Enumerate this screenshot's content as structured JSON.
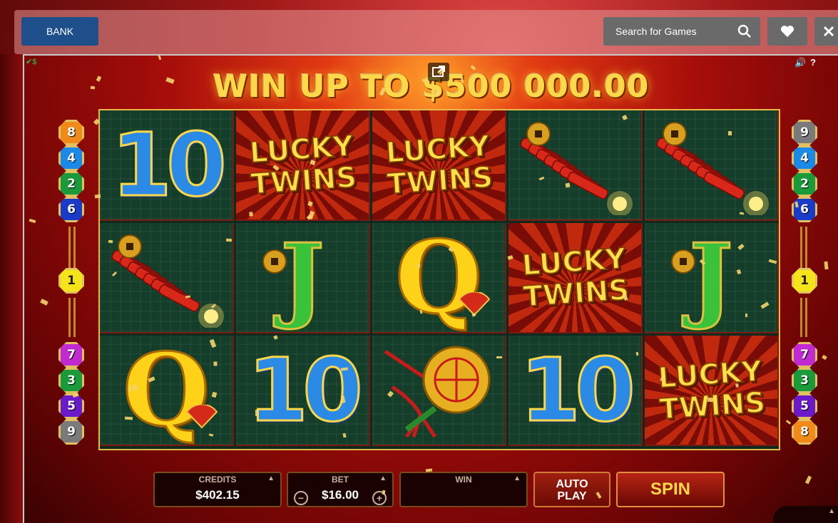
{
  "header": {
    "bank_label": "BANK",
    "search_placeholder": "Search for Games"
  },
  "game": {
    "banner": "WIN UP TO $500 000.00",
    "reels": [
      [
        "10",
        "firecracker",
        "Q"
      ],
      [
        "LUCKY TWINS",
        "J",
        "10"
      ],
      [
        "LUCKY TWINS",
        "Q",
        "knot"
      ],
      [
        "firecracker",
        "LUCKY TWINS",
        "10"
      ],
      [
        "firecracker",
        "J",
        "LUCKY TWINS"
      ]
    ],
    "left_paylines": [
      "8",
      "4",
      "2",
      "6",
      "1",
      "7",
      "3",
      "5",
      "9"
    ],
    "right_paylines": [
      "9",
      "4",
      "2",
      "6",
      "1",
      "7",
      "3",
      "5",
      "8"
    ],
    "controls": {
      "credits_label": "CREDITS",
      "credits_value": "$402.15",
      "bet_label": "BET",
      "bet_value": "$16.00",
      "win_label": "WIN",
      "win_value": "",
      "auto_label_1": "AUTO",
      "auto_label_2": "PLAY",
      "spin_label": "SPIN"
    }
  },
  "colors": {
    "bank": "#1f4f8a",
    "reel_bg": "#143d2a",
    "gold": "#ffd84a"
  }
}
